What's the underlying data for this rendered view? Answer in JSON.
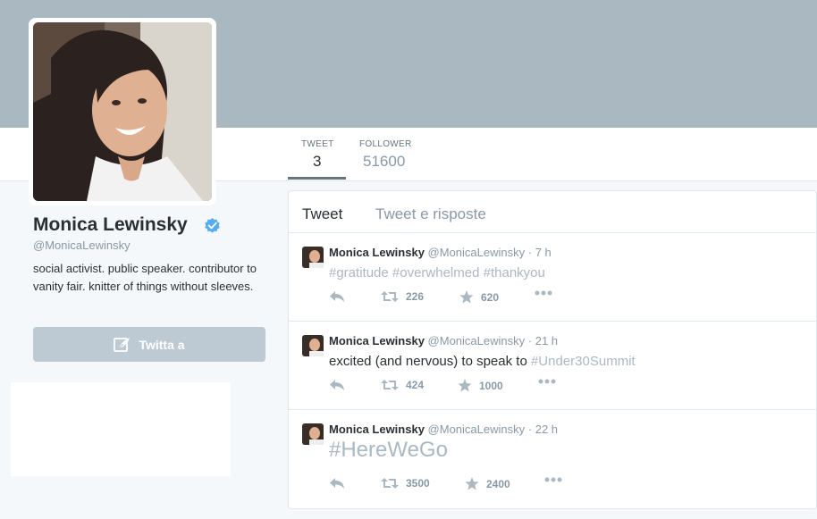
{
  "profile": {
    "name": "Monica Lewinsky",
    "handle": "@MonicaLewinsky",
    "bio": "social activist. public speaker. contributor to vanity fair. knitter of things without sleeves.",
    "tweet_to_label": "Twitta a"
  },
  "stats": {
    "tweet_label": "TWEET",
    "tweet_value": "3",
    "follower_label": "FOLLOWER",
    "follower_value": "51600"
  },
  "tabs": {
    "tweets": "Tweet",
    "replies": "Tweet e risposte"
  },
  "tweets": [
    {
      "name": "Monica Lewinsky",
      "handle": "@MonicaLewinsky",
      "dot": "·",
      "time": "7 h",
      "text_parts": [
        "#gratitude",
        " ",
        "#overwhelmed",
        " ",
        "#thankyou"
      ],
      "retweets": "226",
      "likes": "620"
    },
    {
      "name": "Monica Lewinsky",
      "handle": "@MonicaLewinsky",
      "dot": "·",
      "time": "21 h",
      "text_parts": [
        "excited (and nervous) to speak to ",
        "#Under30Summit"
      ],
      "retweets": "424",
      "likes": "1000"
    },
    {
      "name": "Monica Lewinsky",
      "handle": "@MonicaLewinsky",
      "dot": "·",
      "time": "22 h",
      "text_parts": [
        "#HereWeGo"
      ],
      "retweets": "3500",
      "likes": "2400"
    }
  ],
  "colors": {
    "header": "#aab8c2",
    "hashtag": "#aab8c2",
    "verified": "#55acee",
    "button": "#bdcad3"
  }
}
